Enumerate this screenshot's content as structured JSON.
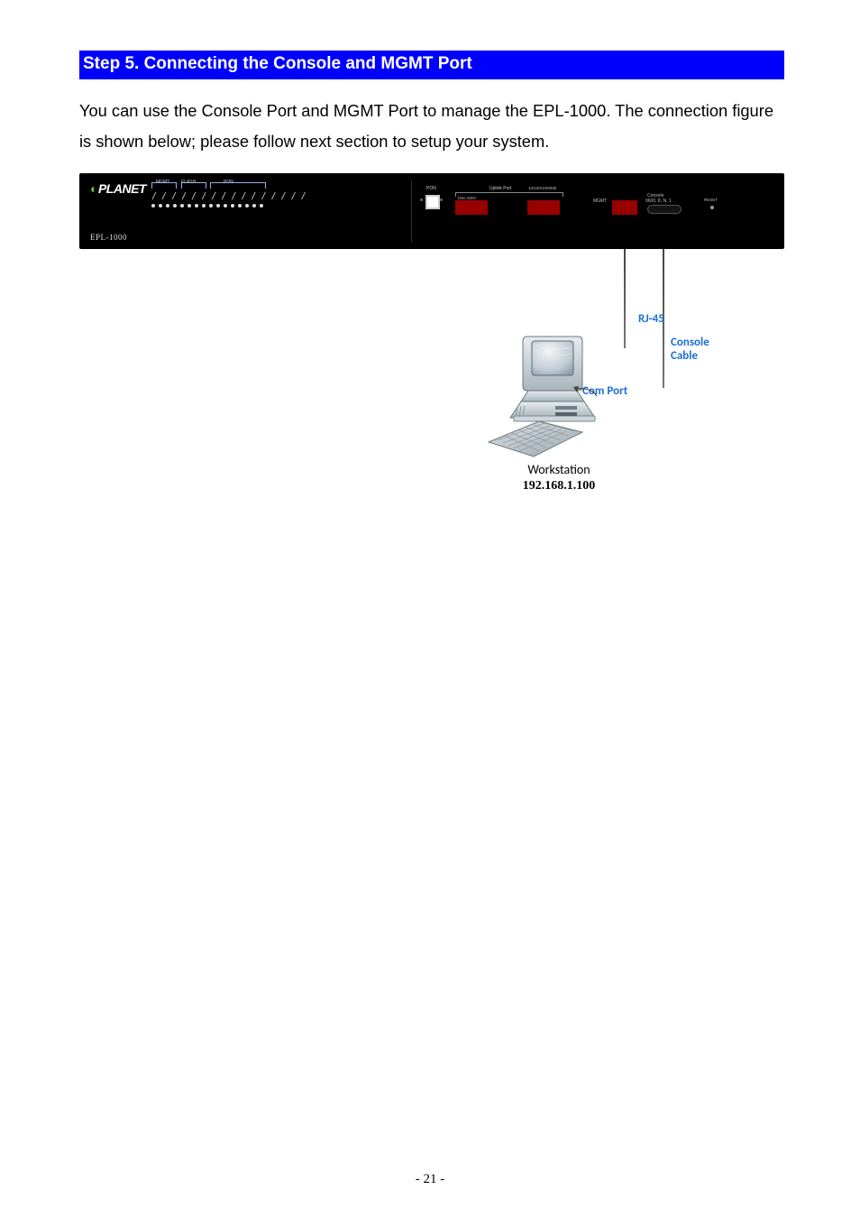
{
  "section": {
    "title": "Step 5. Connecting the Console and MGMT Port"
  },
  "body": {
    "text": "You can use the Console Port and MGMT Port to manage the EPL-1000. The connection figure is shown below; please follow next section to setup your system."
  },
  "device": {
    "brand": "PLANET",
    "model": "EPL-1000",
    "led_groups": [
      "MGMT",
      "FLASH",
      "PON"
    ],
    "ports": {
      "pon": "PON",
      "uplink": "Uplink Port",
      "gbic": "Mini-GBIC",
      "rj45": "10/100/1000Mb",
      "mgmt": "MGMT",
      "console_line1": "Console",
      "console_line2": "9600, 8, N, 1",
      "reset": "RESET"
    }
  },
  "diagram": {
    "rj45_label": "RJ-45",
    "console_cable_label": "Console\nCable",
    "com_port_label": "Com Port",
    "workstation_label": "Workstation",
    "workstation_ip": "192.168.1.100"
  },
  "page": {
    "number": "- 21 -"
  }
}
